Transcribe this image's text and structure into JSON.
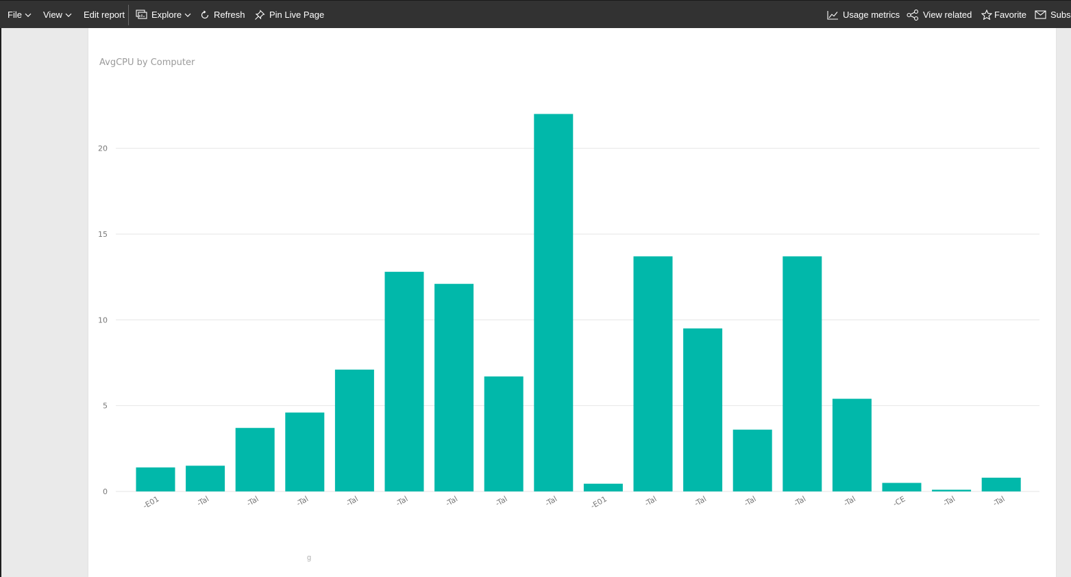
{
  "toolbar": {
    "file": "File",
    "view": "View",
    "edit_report": "Edit report",
    "explore": "Explore",
    "refresh": "Refresh",
    "pin_live_page": "Pin Live Page",
    "usage_metrics": "Usage metrics",
    "view_related": "View related",
    "favorite": "Favorite",
    "subscribe": "Subsc"
  },
  "colors": {
    "toolbar_bg": "#323232",
    "bar": "#01b8aa",
    "gridline": "#e6e6e6",
    "axis_text": "#777777"
  },
  "chart_data": {
    "type": "bar",
    "title": "AvgCPU by Computer",
    "xlabel": "",
    "ylabel": "",
    "ylim": [
      0,
      25
    ],
    "yticks": [
      0,
      5,
      10,
      15,
      20
    ],
    "grid": true,
    "categories": [
      "-E01",
      "-Tal",
      "-Tal",
      "-Tal",
      "-Tal",
      "-Tal",
      "-Tal",
      "-Tal",
      "-Tal",
      "-E01",
      "-Tal",
      "-Tal",
      "-Tal",
      "-Tal",
      "-Tal",
      "-CE",
      "-Tal",
      "-Tal"
    ],
    "values": [
      1.4,
      1.5,
      3.7,
      4.6,
      7.1,
      12.8,
      12.1,
      6.7,
      22.0,
      0.45,
      13.7,
      9.5,
      3.6,
      13.7,
      5.4,
      0.5,
      0.1,
      0.8
    ]
  },
  "stray_mark": "g"
}
